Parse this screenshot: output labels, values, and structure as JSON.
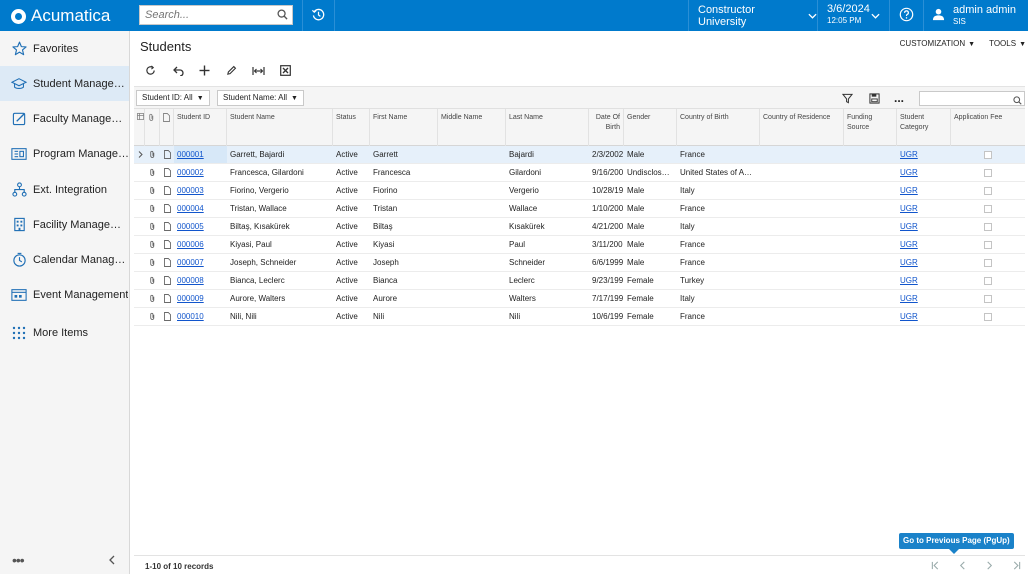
{
  "app": {
    "logo_text": "Acumatica",
    "brand_color": "#007acc"
  },
  "topbar": {
    "search_placeholder": "Search...",
    "tenant": "Constructor University",
    "date": "3/6/2024",
    "time": "12:05 PM",
    "user_name": "admin admin",
    "user_company": "SIS"
  },
  "sidebar": {
    "items": [
      {
        "label": "Favorites",
        "icon": "star-icon"
      },
      {
        "label": "Student Management",
        "icon": "graduation-cap-icon"
      },
      {
        "label": "Faculty Management",
        "icon": "edit-icon"
      },
      {
        "label": "Program Management",
        "icon": "program-icon"
      },
      {
        "label": "Ext. Integration",
        "icon": "hierarchy-icon"
      },
      {
        "label": "Facility Management",
        "icon": "building-icon"
      },
      {
        "label": "Calendar Management",
        "icon": "clock-icon"
      },
      {
        "label": "Event Management",
        "icon": "event-icon"
      },
      {
        "label": "More Items",
        "icon": "grid-dots-icon"
      }
    ],
    "more_glyph": "•••",
    "collapse_glyph": "‹"
  },
  "page": {
    "title": "Students",
    "customization_label": "CUSTOMIZATION",
    "tools_label": "TOOLS"
  },
  "filters": {
    "student_id": "Student ID: All",
    "student_name": "Student Name: All",
    "more_glyph": "..."
  },
  "grid": {
    "columns": {
      "student_id": "Student ID",
      "student_name": "Student Name",
      "status": "Status",
      "first_name": "First Name",
      "middle_name": "Middle Name",
      "last_name": "Last Name",
      "date_of_birth": "Date Of Birth",
      "gender": "Gender",
      "country_of_birth": "Country of Birth",
      "country_of_residence": "Country of Residence",
      "funding_source": "Funding Source",
      "student_category": "Student Category",
      "application_fee": "Application Fee"
    },
    "rows": [
      {
        "id": "000001",
        "name": "Garrett, Bajardi",
        "status": "Active",
        "first": "Garrett",
        "middle": "",
        "last": "Bajardi",
        "dob": "2/3/2002",
        "gender": "Male",
        "cob": "France",
        "cor": "",
        "funding": "",
        "category": "UGR"
      },
      {
        "id": "000002",
        "name": "Francesca, Gilardoni",
        "status": "Active",
        "first": "Francesca",
        "middle": "",
        "last": "Gilardoni",
        "dob": "9/16/200",
        "gender": "Undisclos…",
        "cob": "United States of A…",
        "cor": "",
        "funding": "",
        "category": "UGR"
      },
      {
        "id": "000003",
        "name": "Fiorino, Vergerio",
        "status": "Active",
        "first": "Fiorino",
        "middle": "",
        "last": "Vergerio",
        "dob": "10/28/19",
        "gender": "Male",
        "cob": "Italy",
        "cor": "",
        "funding": "",
        "category": "UGR"
      },
      {
        "id": "000004",
        "name": "Tristan, Wallace",
        "status": "Active",
        "first": "Tristan",
        "middle": "",
        "last": "Wallace",
        "dob": "1/10/200",
        "gender": "Male",
        "cob": "France",
        "cor": "",
        "funding": "",
        "category": "UGR"
      },
      {
        "id": "000005",
        "name": "Biltaş, Kısakürek",
        "status": "Active",
        "first": "Biltaş",
        "middle": "",
        "last": "Kısakürek",
        "dob": "4/21/200",
        "gender": "Male",
        "cob": "Italy",
        "cor": "",
        "funding": "",
        "category": "UGR"
      },
      {
        "id": "000006",
        "name": "Kiyasi, Paul",
        "status": "Active",
        "first": "Kiyasi",
        "middle": "",
        "last": "Paul",
        "dob": "3/11/200",
        "gender": "Male",
        "cob": "France",
        "cor": "",
        "funding": "",
        "category": "UGR"
      },
      {
        "id": "000007",
        "name": "Joseph, Schneider",
        "status": "Active",
        "first": "Joseph",
        "middle": "",
        "last": "Schneider",
        "dob": "6/6/1999",
        "gender": "Male",
        "cob": "France",
        "cor": "",
        "funding": "",
        "category": "UGR"
      },
      {
        "id": "000008",
        "name": "Bianca, Leclerc",
        "status": "Active",
        "first": "Bianca",
        "middle": "",
        "last": "Leclerc",
        "dob": "9/23/199",
        "gender": "Female",
        "cob": "Turkey",
        "cor": "",
        "funding": "",
        "category": "UGR"
      },
      {
        "id": "000009",
        "name": "Aurore, Walters",
        "status": "Active",
        "first": "Aurore",
        "middle": "",
        "last": "Walters",
        "dob": "7/17/199",
        "gender": "Female",
        "cob": "Italy",
        "cor": "",
        "funding": "",
        "category": "UGR"
      },
      {
        "id": "000010",
        "name": "Nili, Nili",
        "status": "Active",
        "first": "Nili",
        "middle": "",
        "last": "Nili",
        "dob": "10/6/199",
        "gender": "Female",
        "cob": "France",
        "cor": "",
        "funding": "",
        "category": "UGR"
      }
    ]
  },
  "footer": {
    "records": "1-10 of 10 records",
    "tooltip": "Go to Previous Page (PgUp)"
  }
}
